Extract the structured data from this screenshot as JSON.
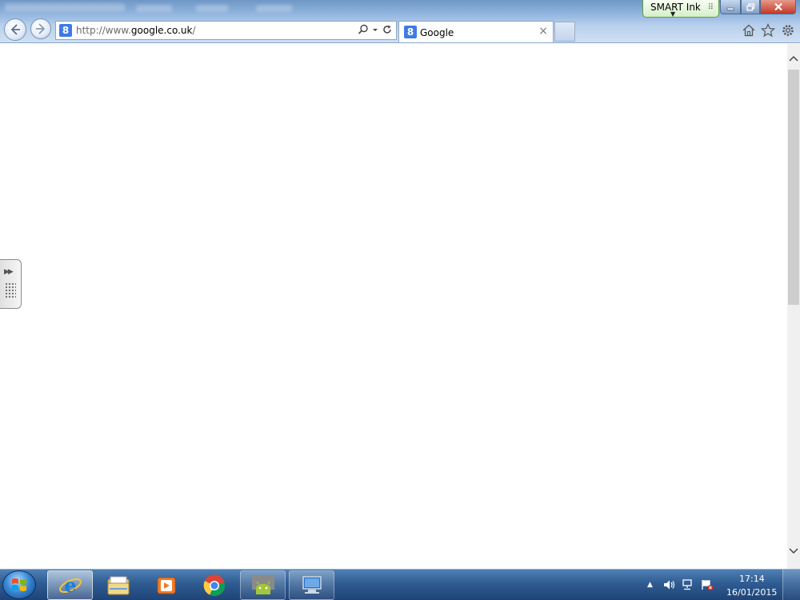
{
  "browser": {
    "address": {
      "url_prefix": "http://www.",
      "url_domain": "google.co.uk",
      "url_suffix": "/",
      "favicon_letter": "8"
    },
    "tab": {
      "label": "Google",
      "favicon_letter": "8",
      "close_glyph": "×"
    },
    "icons": {
      "back": "back-arrow-icon",
      "forward": "forward-arrow-icon",
      "search": "search-icon",
      "refresh": "refresh-icon",
      "home": "home-icon",
      "favorites": "star-icon",
      "tools": "gear-icon"
    }
  },
  "smart_ink": {
    "label": "SMART Ink"
  },
  "window_controls": {
    "minimize": "minimize-icon",
    "maximize": "maximize-icon",
    "close": "close-icon"
  },
  "taskbar": {
    "pinned": [
      "internet-explorer-icon",
      "file-explorer-icon",
      "media-player-icon",
      "chrome-icon",
      "android-icon",
      "remote-desktop-icon"
    ],
    "clock": {
      "time": "17:14",
      "date": "16/01/2015"
    }
  },
  "colors": {
    "taskbar": "#2f5c92",
    "chrome_bar": "#b8d0ec",
    "google_blue": "#3f79e6",
    "close_red": "#c1392a",
    "smart_ink_green": "#d6efc9"
  }
}
